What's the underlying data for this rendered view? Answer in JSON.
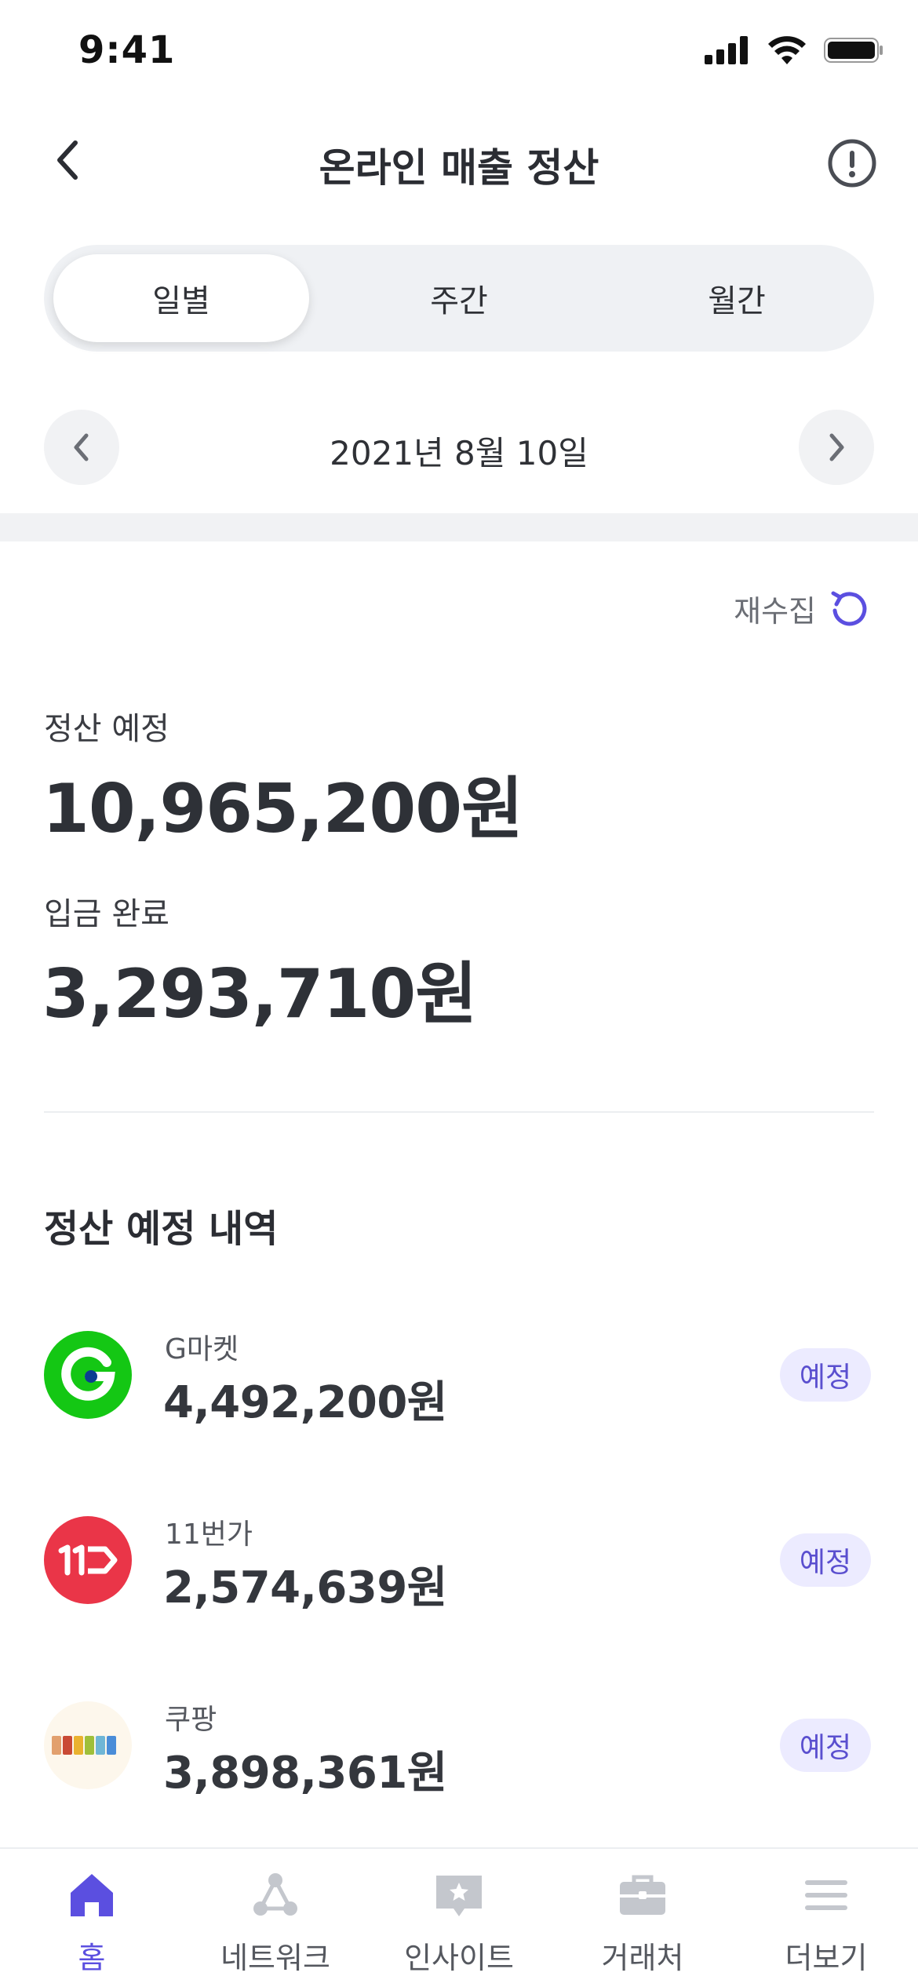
{
  "status_bar": {
    "time": "9:41"
  },
  "header": {
    "title": "온라인 매출 정산"
  },
  "period_tabs": [
    {
      "label": "일별",
      "active": true
    },
    {
      "label": "주간",
      "active": false
    },
    {
      "label": "월간",
      "active": false
    }
  ],
  "date_nav": {
    "date": "2021년 8월 10일"
  },
  "recollect": {
    "label": "재수집"
  },
  "summary": {
    "scheduled_label": "정산 예정",
    "scheduled_amount": "10,965,200원",
    "deposited_label": "입금 완료",
    "deposited_amount": "3,293,710원"
  },
  "schedule_list": {
    "title": "정산 예정 내역",
    "items": [
      {
        "name": "G마켓",
        "amount": "4,492,200원",
        "status": "예정",
        "logo": "gmarket-logo",
        "color": "#14c714"
      },
      {
        "name": "11번가",
        "amount": "2,574,639원",
        "status": "예정",
        "logo": "11st-logo",
        "color": "#ea3548"
      },
      {
        "name": "쿠팡",
        "amount": "3,898,361원",
        "status": "예정",
        "logo": "coupang-logo",
        "color": "#fdf7ec"
      }
    ]
  },
  "tab_bar": [
    {
      "label": "홈",
      "icon": "home-icon",
      "active": true
    },
    {
      "label": "네트워크",
      "icon": "network-icon",
      "active": false
    },
    {
      "label": "인사이트",
      "icon": "insight-icon",
      "active": false
    },
    {
      "label": "거래처",
      "icon": "briefcase-icon",
      "active": false
    },
    {
      "label": "더보기",
      "icon": "menu-icon",
      "active": false
    }
  ],
  "colors": {
    "accent": "#5b4fe0",
    "badge_bg": "#ecebff",
    "inactive_icon": "#c4c7cd"
  }
}
